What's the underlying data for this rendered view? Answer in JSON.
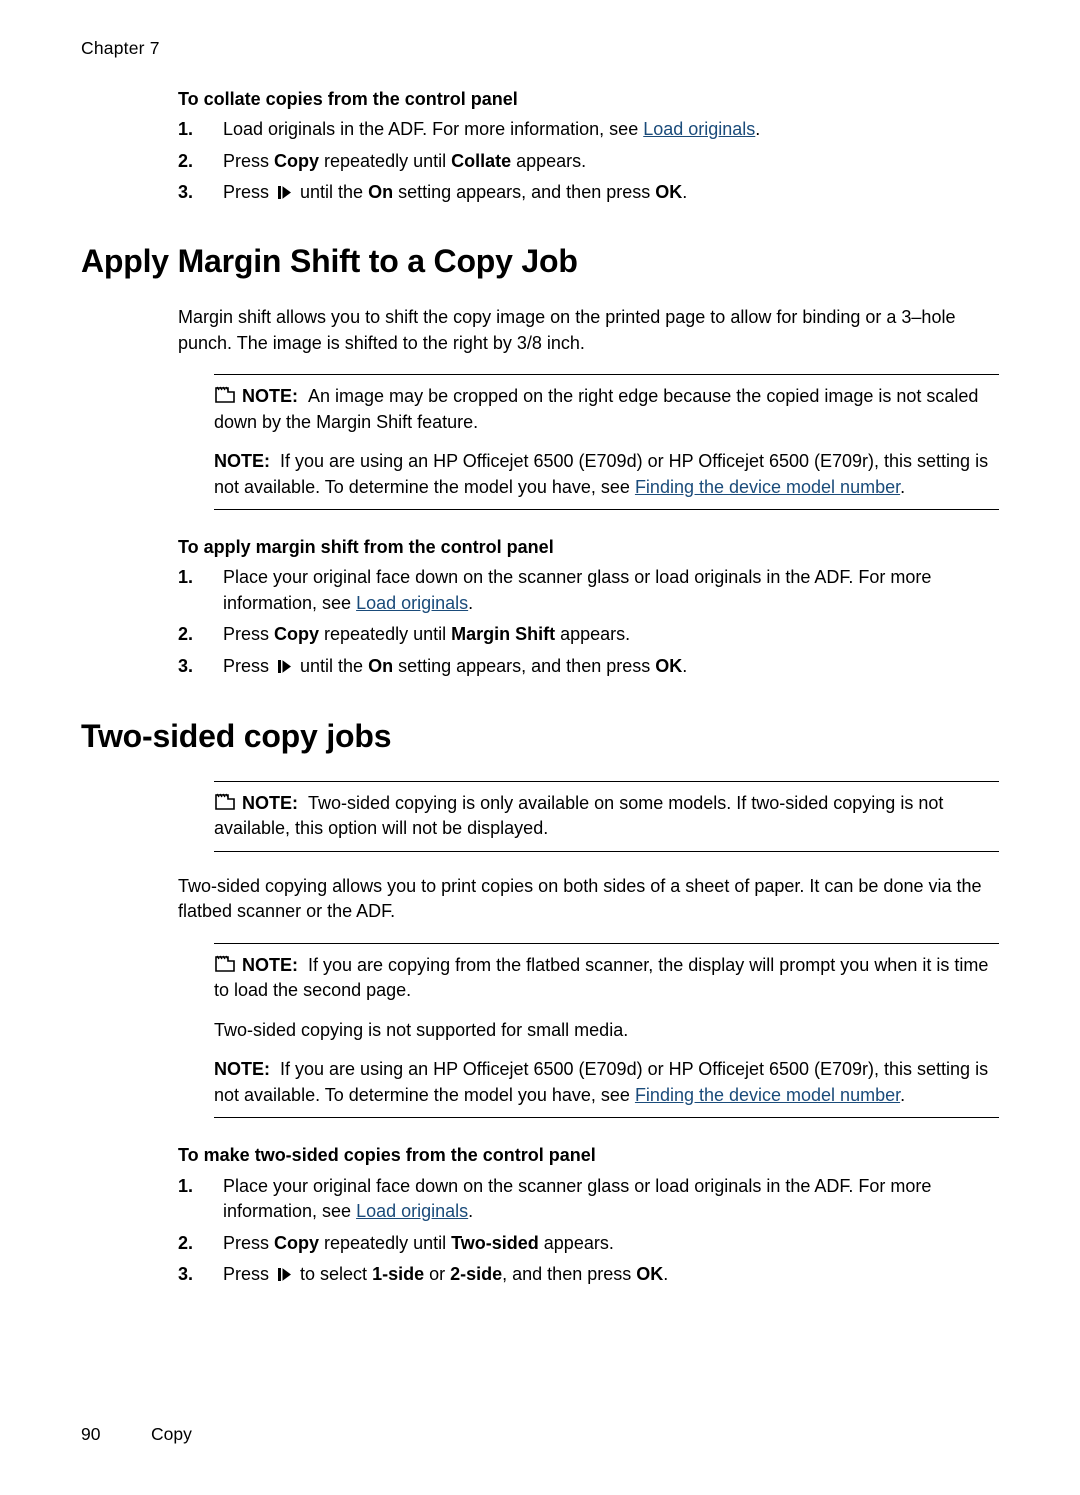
{
  "header": {
    "chapter": "Chapter 7"
  },
  "footer": {
    "page_number": "90",
    "section": "Copy"
  },
  "icons": {
    "note": "note-pencil-icon",
    "arrow": "right-arrow-button-icon"
  },
  "sections": {
    "collate": {
      "heading": "To collate copies from the control panel",
      "steps": [
        {
          "num": "1.",
          "pre": "Load originals in the ADF. For more information, see ",
          "link": "Load originals",
          "post": "."
        },
        {
          "num": "2.",
          "t1": "Press ",
          "b1": "Copy",
          "t2": " repeatedly until ",
          "b2": "Collate",
          "t3": " appears."
        },
        {
          "num": "3.",
          "t1": "Press ",
          "t2": " until the ",
          "b1": "On",
          "t3": " setting appears, and then press ",
          "b2": "OK",
          "t4": "."
        }
      ]
    },
    "margin_shift": {
      "title": "Apply Margin Shift to a Copy Job",
      "intro": "Margin shift allows you to shift the copy image on the printed page to allow for binding or a 3–hole punch. The image is shifted to the right by 3/8 inch.",
      "note1_label": "NOTE:",
      "note1_text": "An image may be cropped on the right edge because the copied image is not scaled down by the Margin Shift feature.",
      "note2_label": "NOTE:",
      "note2_pre": "If you are using an HP Officejet 6500 (E709d) or HP Officejet 6500 (E709r), this setting is not available. To determine the model you have, see ",
      "note2_link": "Finding the device model number",
      "note2_post": ".",
      "heading": "To apply margin shift from the control panel",
      "steps": [
        {
          "num": "1.",
          "pre": "Place your original face down on the scanner glass or load originals in the ADF. For more information, see ",
          "link": "Load originals",
          "post": "."
        },
        {
          "num": "2.",
          "t1": "Press ",
          "b1": "Copy",
          "t2": " repeatedly until ",
          "b2": "Margin Shift",
          "t3": " appears."
        },
        {
          "num": "3.",
          "t1": "Press ",
          "t2": " until the ",
          "b1": "On",
          "t3": " setting appears, and then press ",
          "b2": "OK",
          "t4": "."
        }
      ]
    },
    "two_sided": {
      "title": "Two-sided copy jobs",
      "note1_label": "NOTE:",
      "note1_text": "Two-sided copying is only available on some models. If two-sided copying is not available, this option will not be displayed.",
      "intro": "Two-sided copying allows you to print copies on both sides of a sheet of paper. It can be done via the flatbed scanner or the ADF.",
      "note2_label": "NOTE:",
      "note2_text": "If you are copying from the flatbed scanner, the display will prompt you when it is time to load the second page.",
      "note2_extra": "Two-sided copying is not supported for small media.",
      "note3_label": "NOTE:",
      "note3_pre": "If you are using an HP Officejet 6500 (E709d) or HP Officejet 6500 (E709r), this setting is not available. To determine the model you have, see ",
      "note3_link": "Finding the device model number",
      "note3_post": ".",
      "heading": "To make two-sided copies from the control panel",
      "steps": [
        {
          "num": "1.",
          "pre": "Place your original face down on the scanner glass or load originals in the ADF. For more information, see ",
          "link": "Load originals",
          "post": "."
        },
        {
          "num": "2.",
          "t1": "Press ",
          "b1": "Copy",
          "t2": " repeatedly until ",
          "b2": "Two-sided",
          "t3": " appears."
        },
        {
          "num": "3.",
          "t1": "Press ",
          "t2": " to select ",
          "b1": "1-side",
          "t3": " or ",
          "b2": "2-side",
          "t4": ", and then press ",
          "b3": "OK",
          "t5": "."
        }
      ]
    }
  }
}
